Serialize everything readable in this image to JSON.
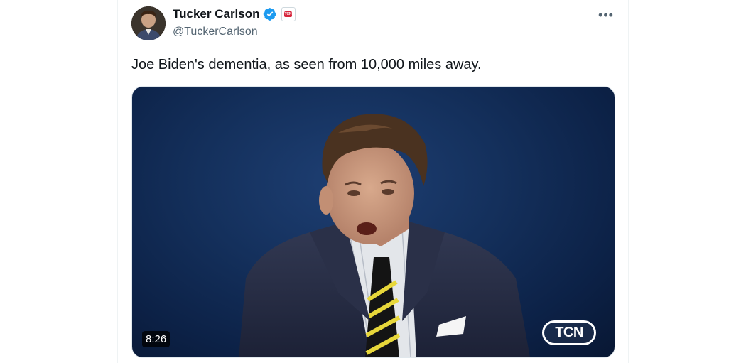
{
  "author": {
    "display_name": "Tucker Carlson",
    "handle": "@TuckerCarlson",
    "verified_icon": "verified-badge-icon",
    "affiliation_badge_text": "TCN",
    "avatar_icon": "profile-photo"
  },
  "menu": {
    "more_label": "•••"
  },
  "tweet": {
    "text": "Joe Biden's dementia, as seen from 10,000 miles away."
  },
  "media": {
    "type": "video",
    "duration": "8:26",
    "watermark": "TCN"
  },
  "colors": {
    "verified_blue": "#1d9bf0",
    "text_primary": "#0f1419",
    "text_secondary": "#536471",
    "video_background": "#0f2a55"
  }
}
